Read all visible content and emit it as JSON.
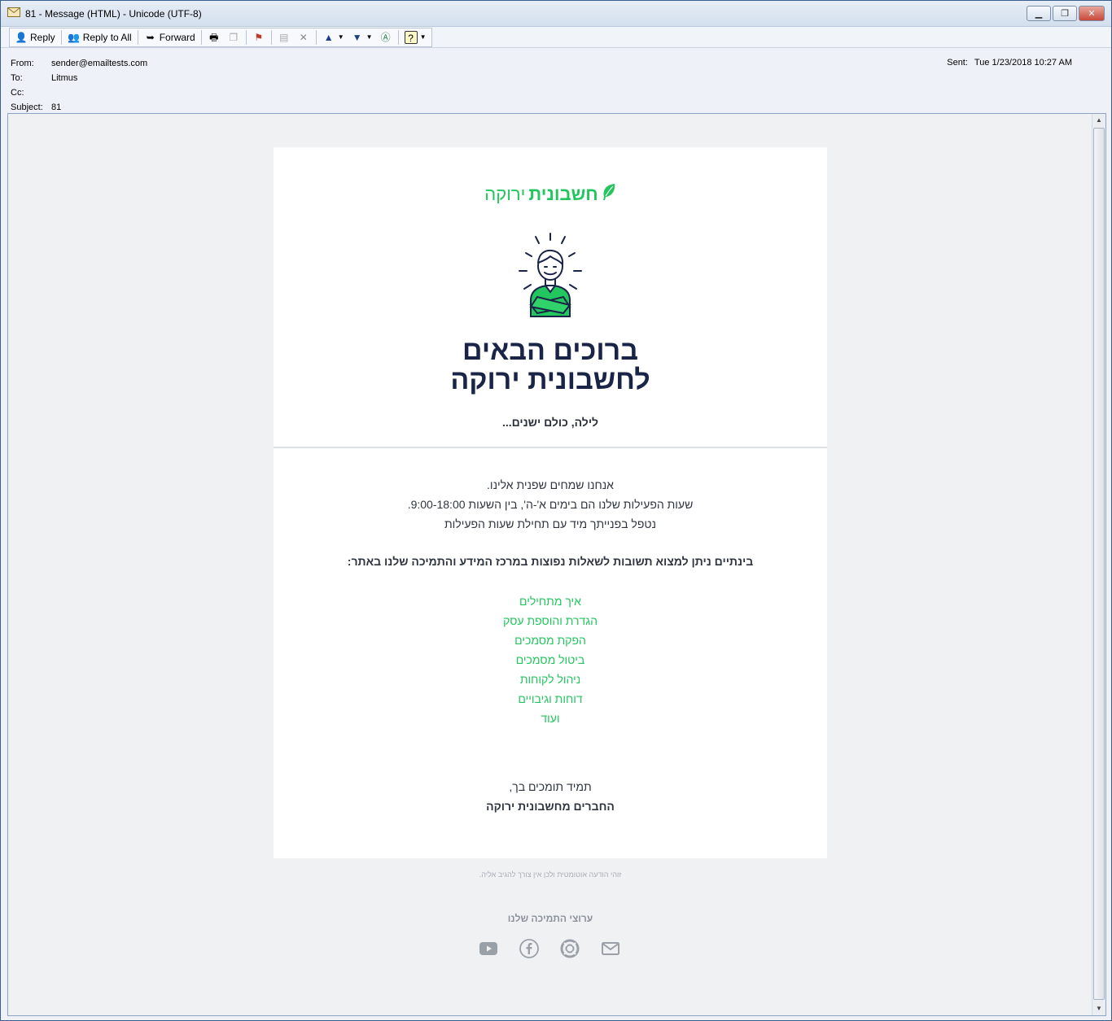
{
  "window": {
    "title": "81 - Message (HTML)  - Unicode (UTF-8)",
    "controls": [
      "minimize",
      "restore",
      "close"
    ]
  },
  "toolbar": {
    "reply_label": "Reply",
    "reply_all_label": "Reply to All",
    "forward_label": "Forward"
  },
  "header": {
    "from_label": "From:",
    "from_value": "sender@emailtests.com",
    "to_label": "To:",
    "to_value": "Litmus",
    "cc_label": "Cc:",
    "cc_value": "",
    "subject_label": "Subject:",
    "subject_value": "81",
    "sent_label": "Sent:",
    "sent_value": "Tue 1/23/2018 10:27 AM"
  },
  "email": {
    "brand_bold": "חשבונית",
    "brand_light": "ירוקה",
    "headline_line1": "ברוכים הבאים",
    "headline_line2": "לחשבונית ירוקה",
    "greeting": "לילה, כולם ישנים...",
    "para_line1": "אנחנו שמחים שפנית אלינו.",
    "para_line2": "שעות הפעילות שלנו הם בימים א'-ה', בין השעות 9:00-18:00.",
    "para_line3": "נטפל בפנייתך מיד עם תחילת שעות הפעילות",
    "meanwhile": "בינתיים ניתן למצוא תשובות לשאלות נפוצות במרכז המידע והתמיכה שלנו באתר:",
    "links": [
      "איך מתחילים",
      "הגדרת והוספת עסק",
      "הפקת מסמכים",
      "ביטול מסמכים",
      "ניהול לקוחות",
      "דוחות וגיבויים",
      "ועוד"
    ],
    "closing_line1": "תמיד תומכים בך,",
    "closing_line2": "החברים מחשבונית ירוקה",
    "footer_note": "זוהי הודעה אוטומטית ולכן אין צורך להגיב אליה.",
    "support_title": "ערוצי התמיכה שלנו"
  },
  "colors": {
    "brand_green": "#22c55e",
    "headline_navy": "#1a2447",
    "social_gray": "#9aa0a8"
  },
  "icons": [
    "youtube-icon",
    "facebook-icon",
    "support-lifebuoy-icon",
    "mail-icon"
  ]
}
